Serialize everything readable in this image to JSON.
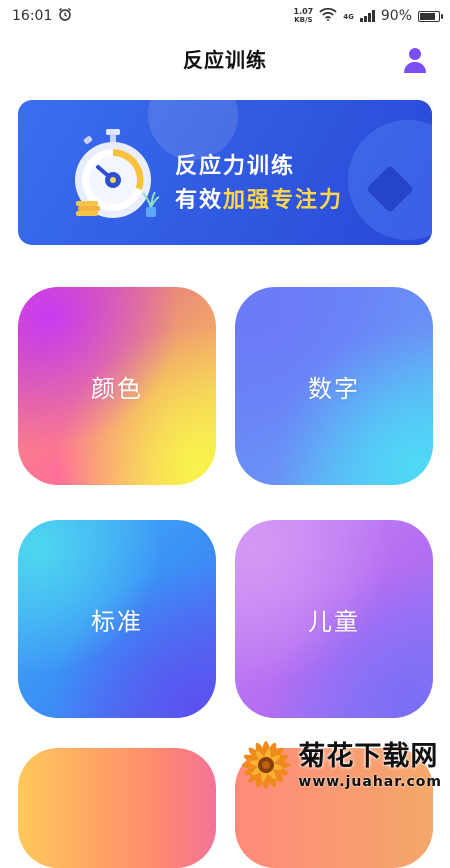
{
  "status_bar": {
    "time": "16:01",
    "net_speed_value": "1.07",
    "net_speed_unit": "KB/S",
    "network_type": "4G",
    "battery": "90%",
    "battery_level": 0.9,
    "icons": [
      "alarm-icon",
      "wifi-icon",
      "signal-icon",
      "battery-icon"
    ]
  },
  "header": {
    "title": "反应训练",
    "profile_icon": "user-icon",
    "accent": "#7b4df2"
  },
  "banner": {
    "line1": "反应力训练",
    "line2_normal": "有效",
    "line2_highlight": "加强专注力",
    "background": "#3a62e6",
    "highlight_color": "#ffd84a"
  },
  "tiles": [
    {
      "label": "颜色"
    },
    {
      "label": "数字"
    },
    {
      "label": "标准"
    },
    {
      "label": "儿童"
    }
  ],
  "watermark": {
    "title": "菊花下载网",
    "url": "www.juahar.com"
  }
}
